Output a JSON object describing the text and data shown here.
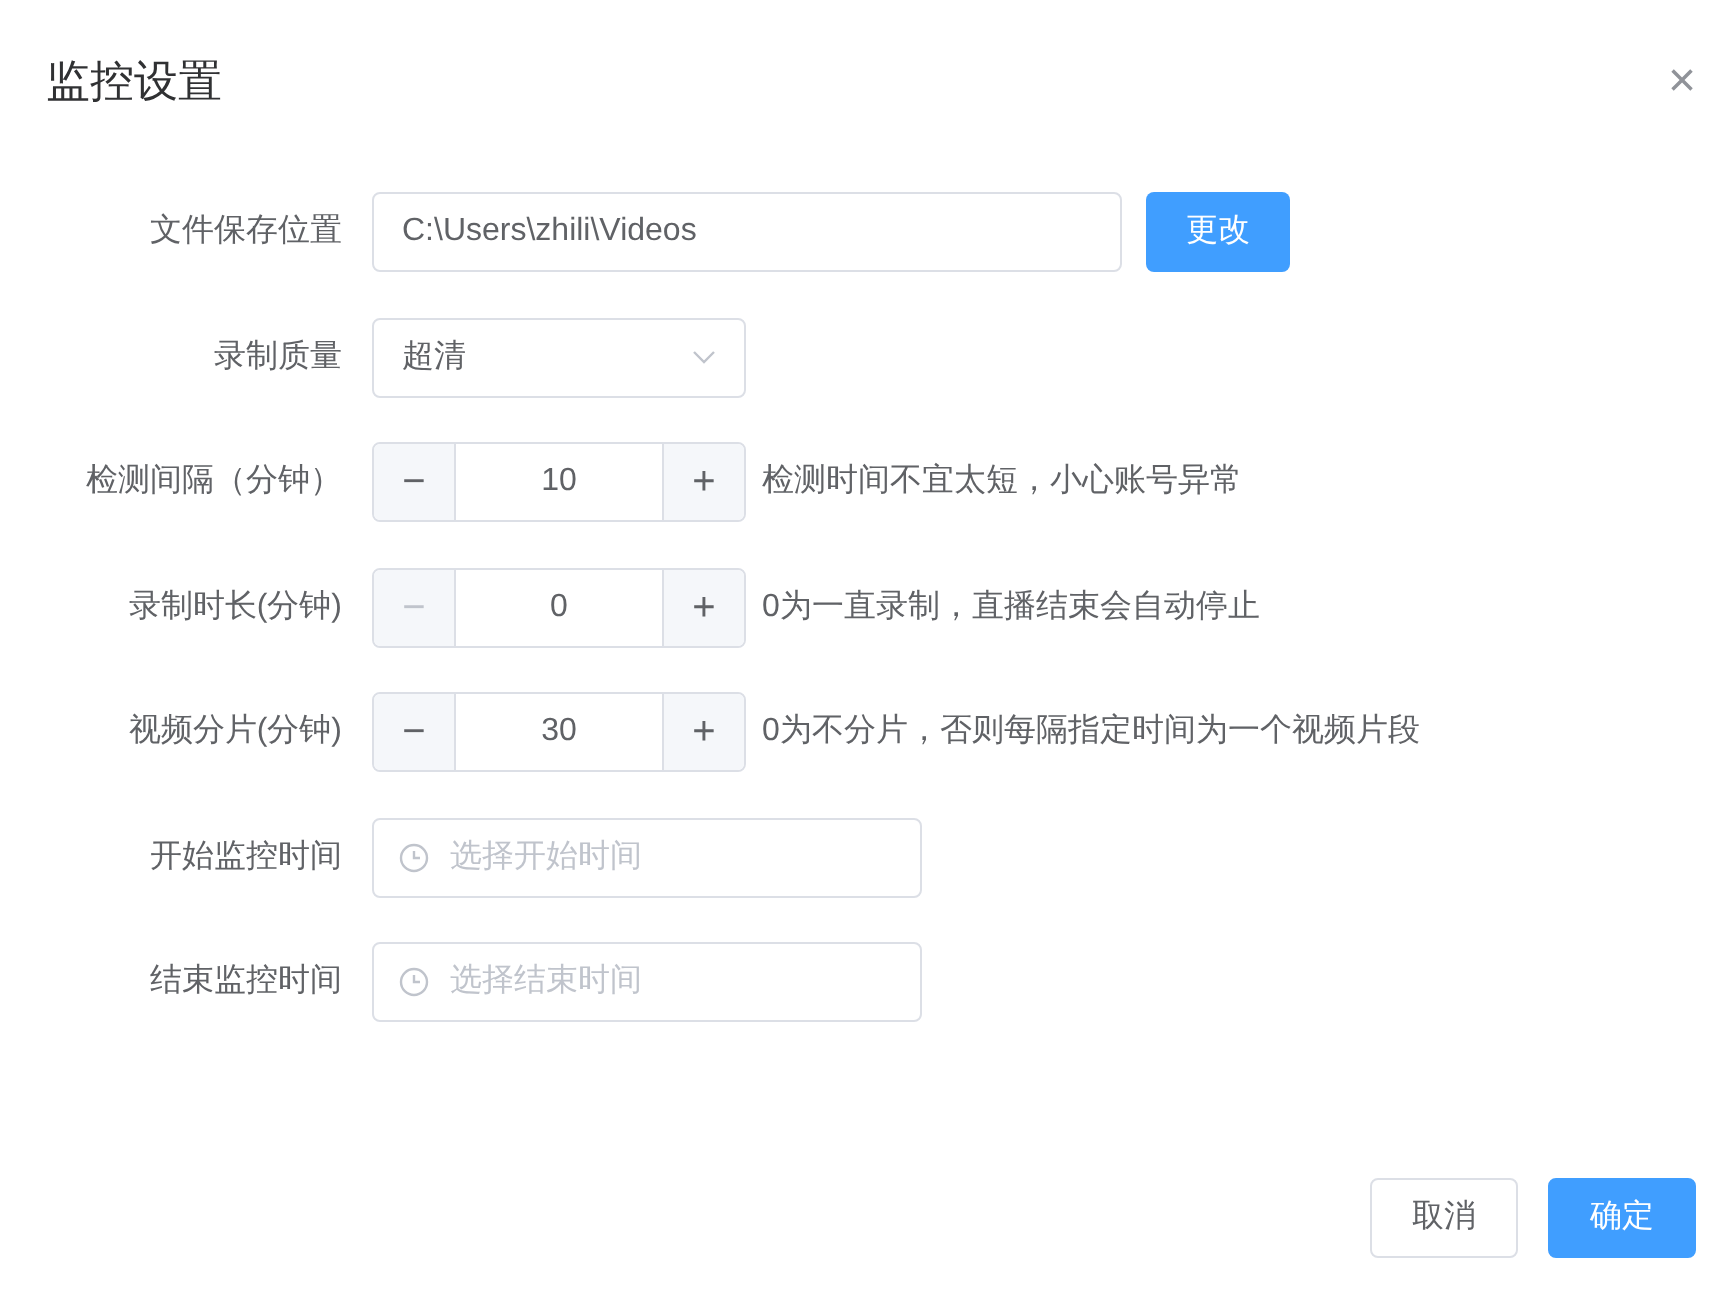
{
  "dialog": {
    "title": "监控设置",
    "close": "×"
  },
  "fields": [
    {
      "kind": "path",
      "label": "文件保存位置",
      "value": "C:\\Users\\zhili\\Videos",
      "button": "更改"
    },
    {
      "kind": "select",
      "label": "录制质量",
      "value": "超清"
    },
    {
      "kind": "stepper",
      "label": "检测间隔（分钟）",
      "value": "10",
      "minus": "−",
      "plus": "+",
      "decrease_disabled": false,
      "hint": "检测时间不宜太短，小心账号异常"
    },
    {
      "kind": "stepper",
      "label": "录制时长(分钟)",
      "value": "0",
      "minus": "−",
      "plus": "+",
      "decrease_disabled": true,
      "hint": "0为一直录制，直播结束会自动停止"
    },
    {
      "kind": "stepper",
      "label": "视频分片(分钟)",
      "value": "30",
      "minus": "−",
      "plus": "+",
      "decrease_disabled": false,
      "hint": "0为不分片，否则每隔指定时间为一个视频片段"
    },
    {
      "kind": "time",
      "label": "开始监控时间",
      "placeholder": "选择开始时间"
    },
    {
      "kind": "time",
      "label": "结束监控时间",
      "placeholder": "选择结束时间"
    }
  ],
  "buttons": [
    {
      "kind": "secondary",
      "label": "取消"
    },
    {
      "kind": "primary",
      "label": "确定"
    }
  ]
}
